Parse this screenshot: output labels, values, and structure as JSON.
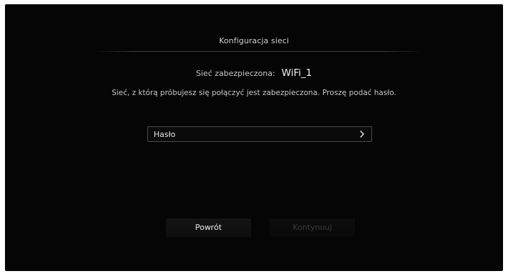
{
  "dialog": {
    "title": "Konfiguracja sieci",
    "network_label": "Sieć zabezpieczona:",
    "network_name": "WiFi_1",
    "message": "Sieć, z którą próbujesz się połączyć jest zabezpieczona. Proszę podać hasło.",
    "password_field": {
      "label": "Hasło",
      "icon": "chevron-right-icon"
    },
    "buttons": {
      "back_label": "Powrót",
      "continue_label": "Kontynuuj",
      "continue_state": "disabled"
    }
  },
  "colors": {
    "background": "#050505",
    "text_primary": "#f2f2f2",
    "text_secondary": "#c8c8c8",
    "disabled_text": "#3a3a3a"
  }
}
